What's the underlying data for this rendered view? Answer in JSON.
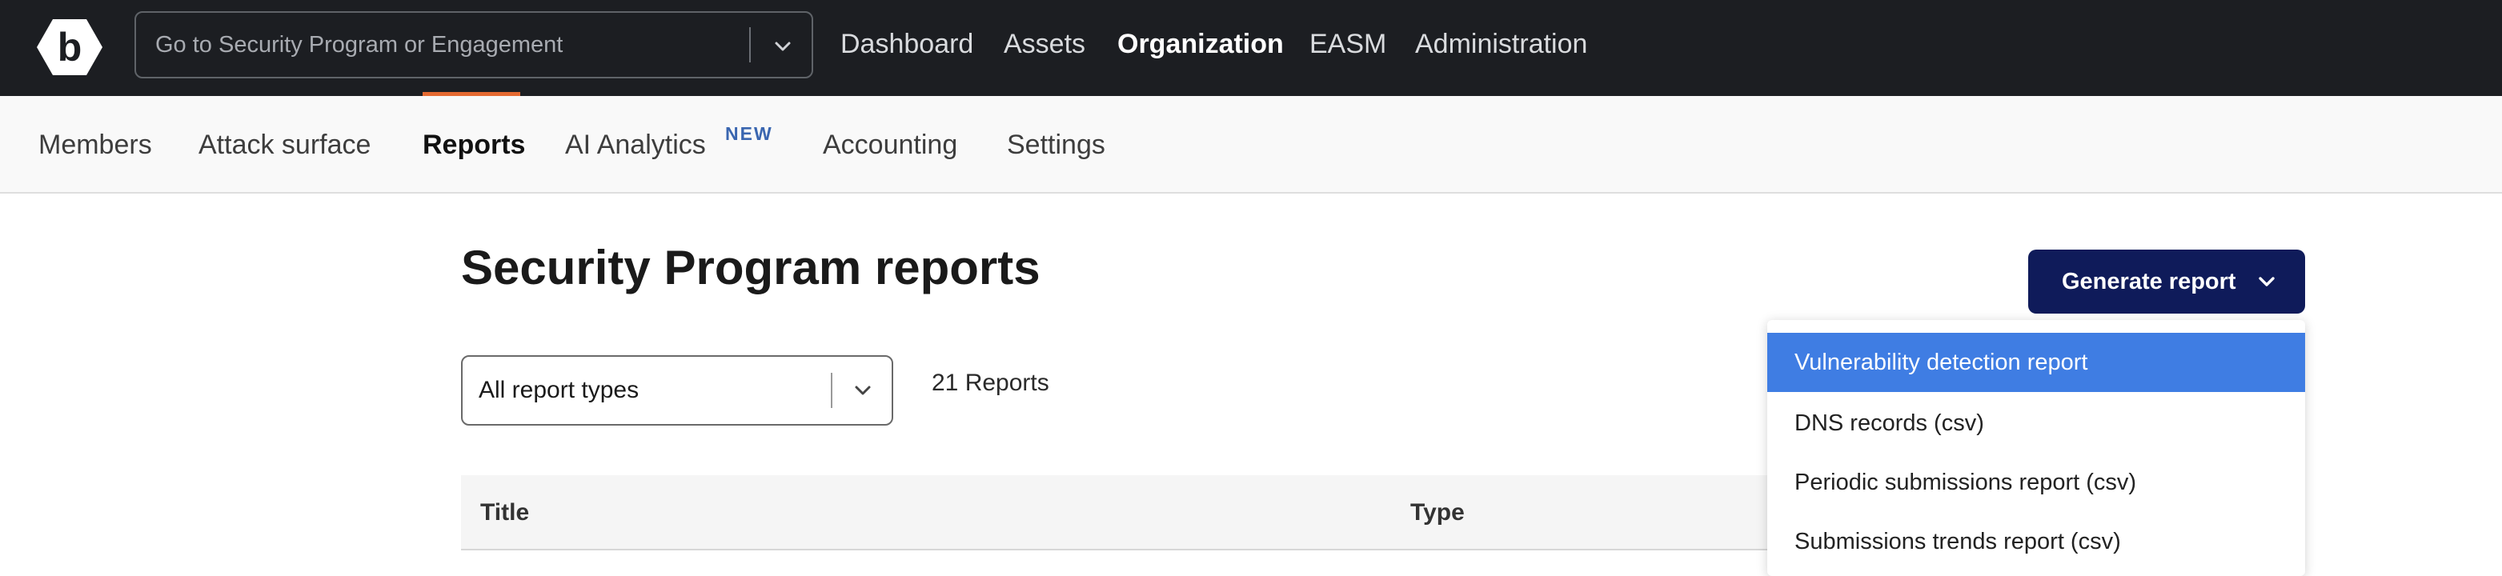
{
  "topbar": {
    "search_placeholder": "Go to Security Program or Engagement",
    "nav": [
      {
        "label": "Dashboard"
      },
      {
        "label": "Assets"
      },
      {
        "label": "Organization"
      },
      {
        "label": "EASM"
      },
      {
        "label": "Administration"
      }
    ],
    "active_nav": "Organization"
  },
  "subnav": {
    "tabs": [
      {
        "label": "Members"
      },
      {
        "label": "Attack surface"
      },
      {
        "label": "Reports"
      },
      {
        "label": "AI Analytics"
      },
      {
        "label": "Accounting"
      },
      {
        "label": "Settings"
      }
    ],
    "active_tab": "Reports",
    "new_badge": "NEW"
  },
  "main": {
    "title": "Security Program reports",
    "filter_value": "All report types",
    "count": "21 Reports",
    "table_headers": [
      "Title",
      "Type"
    ]
  },
  "generate": {
    "label": "Generate report",
    "menu": [
      "Vulnerability detection report",
      "DNS records (csv)",
      "Periodic submissions report (csv)",
      "Submissions trends report (csv)"
    ],
    "highlighted": "Vulnerability detection report"
  },
  "colors": {
    "topbar_bg": "#1c1e22",
    "accent_underline": "#e56a31",
    "button_bg": "#0f1b5a",
    "menu_highlight": "#3f7de3",
    "new_badge": "#3a66b0"
  },
  "icons": [
    "bugcrowd-logo-icon",
    "chevron-down-icon"
  ]
}
